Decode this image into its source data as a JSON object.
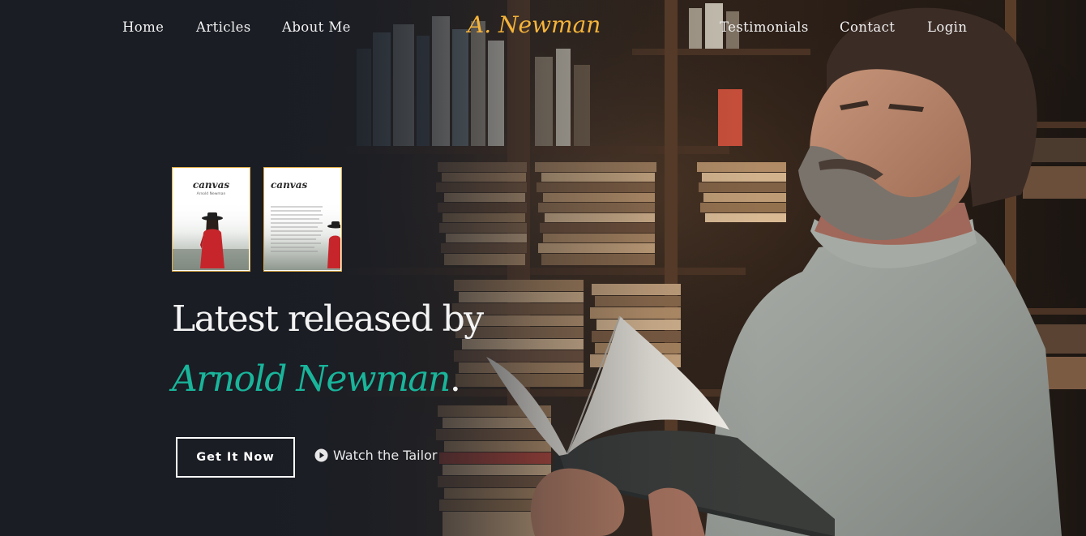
{
  "nav": {
    "left_links": [
      "Home",
      "Articles",
      "About Me"
    ],
    "brand": "A. Newman",
    "right_links": [
      "Testimonials",
      "Contact",
      "Login"
    ]
  },
  "books": [
    {
      "title": "canvas",
      "author": "Arnold Newman"
    },
    {
      "title": "canvas"
    }
  ],
  "hero": {
    "headline": "Latest released by",
    "author_name": "Arnold Newman",
    "author_punct": "."
  },
  "actions": {
    "primary_label": "Get It Now",
    "secondary_label": "Watch the Tailor",
    "secondary_icon": "play-circle-icon"
  },
  "colors": {
    "brand": "#f5b43a",
    "accent": "#19b59b",
    "background": "#1b1e25",
    "cover_border": "#e0ad45"
  }
}
